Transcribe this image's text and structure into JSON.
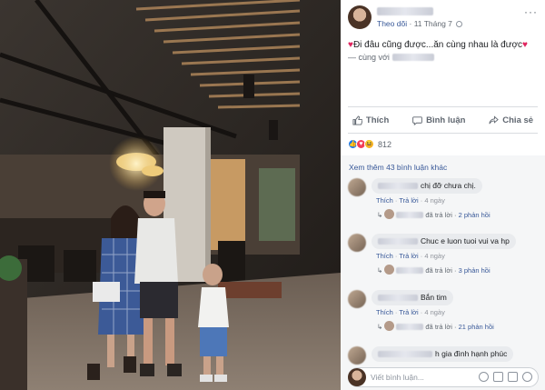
{
  "post": {
    "follow_label": "Theo dõi",
    "separator": "·",
    "date": "11 Tháng 7",
    "more": "···",
    "caption_heart_left": "♥",
    "caption_text": "Đi đâu cũng được...ăn cùng nhau là được",
    "caption_heart_right": "♥",
    "with_prefix": "— cùng với"
  },
  "actions": {
    "like": "Thích",
    "comment": "Bình luận",
    "share": "Chia sẻ"
  },
  "reactions": {
    "like_glyph": "👍",
    "love_glyph": "♥",
    "haha_glyph": "😆",
    "count": "812"
  },
  "comments": {
    "view_more": "Xem thêm 43 bình luận khác",
    "items": [
      {
        "text": "chị đỡ chưa chị.",
        "like": "Thích",
        "reply": "Trả lời",
        "time": "4 ngày",
        "replied": "đã trả lời",
        "replies": "2 phản hồi"
      },
      {
        "text": "Chuc e luon tuoi vui va hp",
        "like": "Thích",
        "reply": "Trả lời",
        "time": "4 ngày",
        "replied": "đã trả lời",
        "replies": "3 phản hồi"
      },
      {
        "text": "Bắn tim",
        "like": "Thích",
        "reply": "Trả lời",
        "time": "4 ngày",
        "replied": "đã trả lời",
        "replies": "21 phản hồi"
      },
      {
        "text": "h gia đình hạnh phúc"
      }
    ],
    "dot": "·",
    "reply_arrow": "↳"
  },
  "composer": {
    "placeholder": "Viết bình luận..."
  },
  "colors": {
    "link": "#385898",
    "muted": "#606770",
    "heart": "#e0245e",
    "like_blue": "#1877f2"
  }
}
